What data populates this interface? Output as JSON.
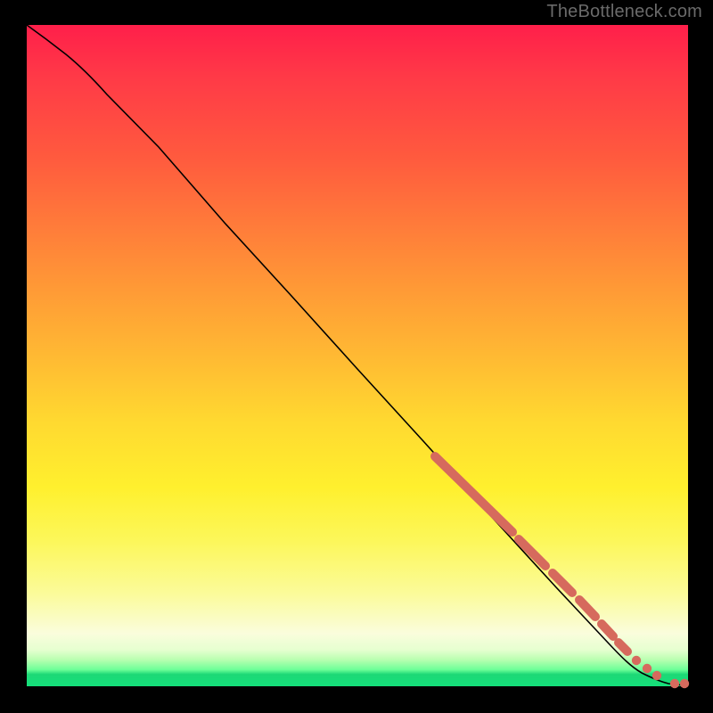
{
  "attribution": "TheBottleneck.com",
  "chart_data": {
    "type": "line",
    "title": "",
    "xlabel": "",
    "ylabel": "",
    "xlim": [
      0,
      100
    ],
    "ylim": [
      0,
      100
    ],
    "grid": false,
    "background_gradient": [
      "#ff1f4a",
      "#ff7a3a",
      "#ffd930",
      "#fbfb9a",
      "#14e07a"
    ],
    "series": [
      {
        "name": "bottleneck-curve",
        "type": "line",
        "color": "#000000",
        "x": [
          0,
          3,
          6,
          10,
          15,
          20,
          30,
          40,
          50,
          60,
          70,
          80,
          88,
          92,
          95,
          97,
          98.5,
          100
        ],
        "values": [
          100,
          98,
          95.5,
          92,
          87,
          81.5,
          70,
          59,
          48,
          37,
          26,
          15,
          6.5,
          3.0,
          1.3,
          0.5,
          0.2,
          0.15
        ]
      },
      {
        "name": "highlighted-segments",
        "type": "scatter",
        "color": "#d66a5d",
        "comment": "Thick red-orange marker clusters sitting on the curve in the lower-right region; values approximate positions along the x-axis where markers appear dense.",
        "x": [
          62,
          64,
          66,
          68,
          70,
          72,
          74,
          76,
          78,
          80,
          82,
          84,
          86,
          88,
          90,
          92,
          93.5,
          95,
          97.5,
          99.5
        ],
        "values": [
          35,
          32.8,
          30.6,
          28.4,
          26,
          23.7,
          21.5,
          19.3,
          17,
          15,
          12.8,
          10.7,
          8.6,
          6.5,
          4.5,
          3.0,
          2.1,
          1.3,
          0.4,
          0.15
        ]
      }
    ]
  },
  "colors": {
    "marker": "#d66a5d",
    "curve": "#000000"
  }
}
